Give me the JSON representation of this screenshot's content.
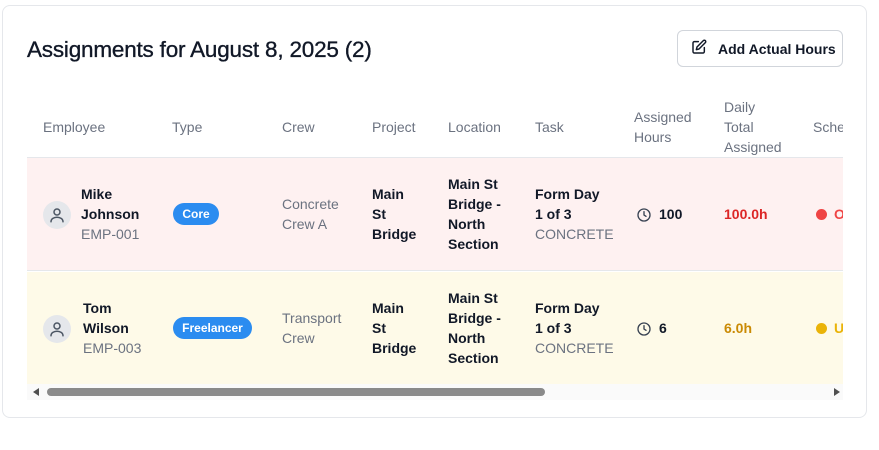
{
  "header": {
    "title": "Assignments for August 8, 2025 (2)",
    "add_button_label": "Add Actual Hours"
  },
  "table": {
    "columns": [
      "Employee",
      "Type",
      "Crew",
      "Project",
      "Location",
      "Task",
      "Assigned Hours",
      "Daily Total Assigned",
      "Sche"
    ],
    "column_lines": {
      "assigned": [
        "Assigned",
        "Hours"
      ],
      "daily": [
        "Daily",
        "Total",
        "Assigned"
      ]
    },
    "rows": [
      {
        "name_lines": [
          "Mike",
          "Johnson"
        ],
        "emp_id": "EMP-001",
        "type": "Core",
        "crew_lines": [
          "Concrete",
          "Crew A"
        ],
        "project_lines": [
          "Main",
          "St",
          "Bridge"
        ],
        "location_lines": [
          "Main St",
          "Bridge -",
          "North",
          "Section"
        ],
        "task_lines": [
          "Form Day",
          "1 of 3"
        ],
        "task_type": "CONCRETE",
        "assigned_hours": "100",
        "daily_total": "100.0h",
        "daily_color": "#dc2626",
        "status_text": "O",
        "status_color": "#ef4444",
        "row_bg": "#fef1f1"
      },
      {
        "name_lines": [
          "Tom",
          "Wilson"
        ],
        "emp_id": "EMP-003",
        "type": "Freelancer",
        "crew_lines": [
          "Transport",
          "Crew"
        ],
        "project_lines": [
          "Main",
          "St",
          "Bridge"
        ],
        "location_lines": [
          "Main St",
          "Bridge -",
          "North",
          "Section"
        ],
        "task_lines": [
          "Form Day",
          "1 of 3"
        ],
        "task_type": "CONCRETE",
        "assigned_hours": "6",
        "daily_total": "6.0h",
        "daily_color": "#ca8a04",
        "status_text": "U",
        "status_color": "#eab308",
        "row_bg": "#fefae8"
      }
    ]
  },
  "icons": {
    "add_button": "edit-square-icon",
    "avatar": "user-icon",
    "hours": "clock-icon"
  },
  "scrollbar": {
    "position_fraction": 0.0,
    "visible_fraction": 0.62
  }
}
